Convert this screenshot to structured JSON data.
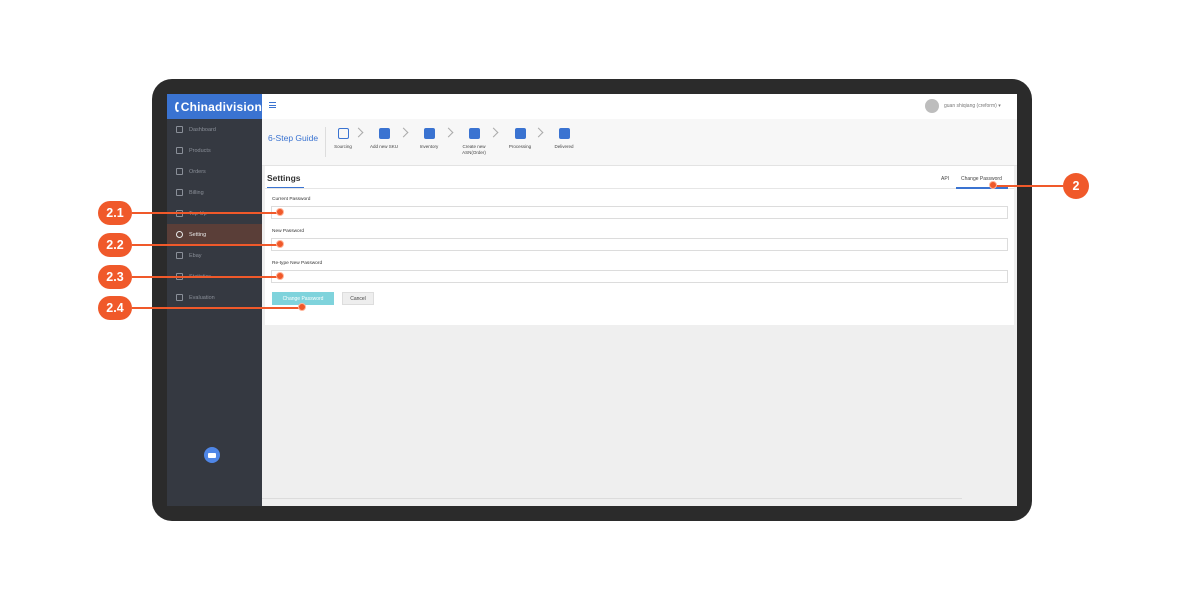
{
  "app": {
    "logo_text": "Chinadivision"
  },
  "sidebar": {
    "items": [
      {
        "label": "Dashboard",
        "icon": "home-icon"
      },
      {
        "label": "Products",
        "icon": "box-icon"
      },
      {
        "label": "Orders",
        "icon": "list-icon"
      },
      {
        "label": "Billing",
        "icon": "coin-icon"
      },
      {
        "label": "Top-Up",
        "icon": "wallet-icon"
      },
      {
        "label": "Setting",
        "icon": "gear-icon",
        "active": true
      },
      {
        "label": "Ebay",
        "icon": "ebay-icon"
      },
      {
        "label": "Statistics",
        "icon": "chart-icon"
      },
      {
        "label": "Evaluation",
        "icon": "bars-icon"
      }
    ]
  },
  "topbar": {
    "user": "guan shiqiang (creform) ▾"
  },
  "guide": {
    "title": "6-Step Guide",
    "steps": [
      {
        "label": "Sourcing",
        "icon": "cart-icon"
      },
      {
        "label": "Add new SKU",
        "icon": "truck-icon"
      },
      {
        "label": "Inventory",
        "icon": "inventory-icon"
      },
      {
        "label": "Create new ASN(Order)",
        "icon": "money-bag-icon"
      },
      {
        "label": "Processing",
        "icon": "dolly-icon"
      },
      {
        "label": "Delivered",
        "icon": "package-icon"
      }
    ]
  },
  "settings": {
    "title": "Settings",
    "tabs": [
      "API",
      "Change Password"
    ],
    "fields": [
      {
        "label": "Current Password",
        "value": ""
      },
      {
        "label": "New Password",
        "value": ""
      },
      {
        "label": "Re-type New Password",
        "value": ""
      }
    ],
    "submit_label": "Change Password",
    "cancel_label": "Cancel"
  },
  "annotations": [
    "2",
    "2.1",
    "2.2",
    "2.3",
    "2.4"
  ],
  "colors": {
    "brand_blue": "#3a73d1",
    "sidebar_bg": "#353941",
    "active_item_bg": "#5a3e38",
    "primary_button": "#7fd3dc",
    "annotation": "#f0592a"
  }
}
